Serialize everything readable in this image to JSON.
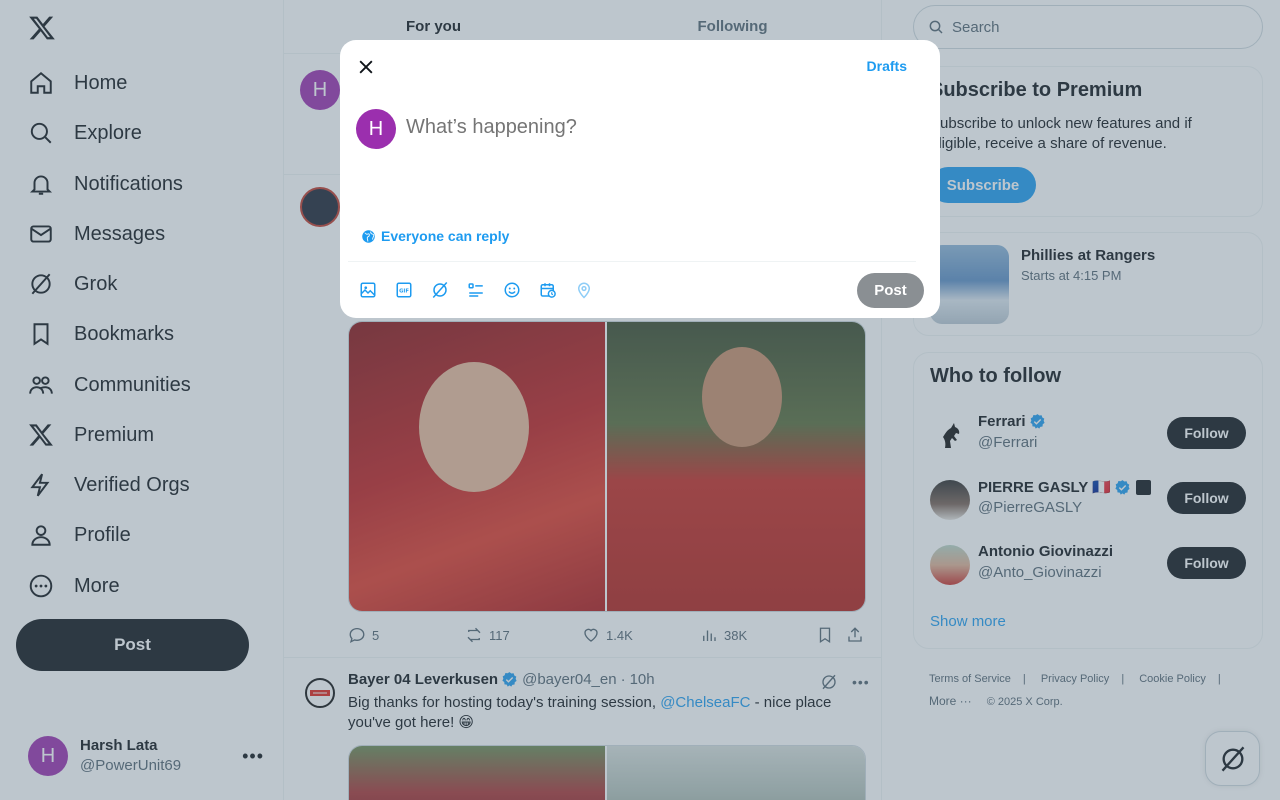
{
  "nav": {
    "items": [
      {
        "label": "Home",
        "icon": "home-icon"
      },
      {
        "label": "Explore",
        "icon": "search-icon"
      },
      {
        "label": "Notifications",
        "icon": "bell-icon"
      },
      {
        "label": "Messages",
        "icon": "mail-icon"
      },
      {
        "label": "Grok",
        "icon": "grok-icon"
      },
      {
        "label": "Bookmarks",
        "icon": "bookmark-icon"
      },
      {
        "label": "Communities",
        "icon": "people-icon"
      },
      {
        "label": "Premium",
        "icon": "x-logo-icon"
      },
      {
        "label": "Verified Orgs",
        "icon": "lightning-icon"
      },
      {
        "label": "Profile",
        "icon": "person-icon"
      },
      {
        "label": "More",
        "icon": "more-circle-icon"
      }
    ],
    "post_label": "Post"
  },
  "account": {
    "initial": "H",
    "name": "Harsh Lata",
    "handle": "@PowerUnit69"
  },
  "timeline": {
    "tabs": [
      "For you",
      "Following"
    ],
    "first_avatar_initial": "H",
    "tweet1_actions": {
      "replies": "5",
      "reposts": "117",
      "likes": "1.4K",
      "views": "38K"
    },
    "tweet2": {
      "author": "Bayer 04 Leverkusen",
      "handle": "@bayer04_en",
      "time": "10h",
      "text_before": "Big thanks for hosting today's training session, ",
      "mention": "@ChelseaFC",
      "text_after": " - nice place you've got here! 😁"
    }
  },
  "search": {
    "placeholder": "Search"
  },
  "premium": {
    "title": "Subscribe to Premium",
    "description": "Subscribe to unlock new features and if eligible, receive a share of revenue.",
    "button": "Subscribe"
  },
  "event": {
    "title": "Phillies at Rangers",
    "time": "Starts at 4:15 PM"
  },
  "who_to_follow": {
    "title": "Who to follow",
    "follow_label": "Follow",
    "accounts": [
      {
        "name": "Ferrari",
        "handle": "@Ferrari"
      },
      {
        "name": "PIERRE GASLY 🇫🇷",
        "handle": "@PierreGASLY"
      },
      {
        "name": "Antonio Giovinazzi",
        "handle": "@Anto_Giovinazzi"
      }
    ],
    "show_more": "Show more"
  },
  "footer": {
    "links": [
      "Terms of Service",
      "Privacy Policy",
      "Cookie Policy"
    ],
    "more": "More ···",
    "copyright": "© 2025 X Corp."
  },
  "compose": {
    "drafts": "Drafts",
    "avatar_initial": "H",
    "placeholder": "What’s happening?",
    "reply_setting": "Everyone can reply",
    "post_label": "Post",
    "tools": [
      "image-icon",
      "gif-icon",
      "grok-icon",
      "poll-icon",
      "emoji-icon",
      "schedule-icon",
      "location-icon"
    ]
  },
  "colors": {
    "accent": "#1d9bf0",
    "text": "#0f1419",
    "muted": "#536471",
    "avatar": "#9b2fae",
    "overlay": "rgba(91,112,131,0.4)"
  }
}
